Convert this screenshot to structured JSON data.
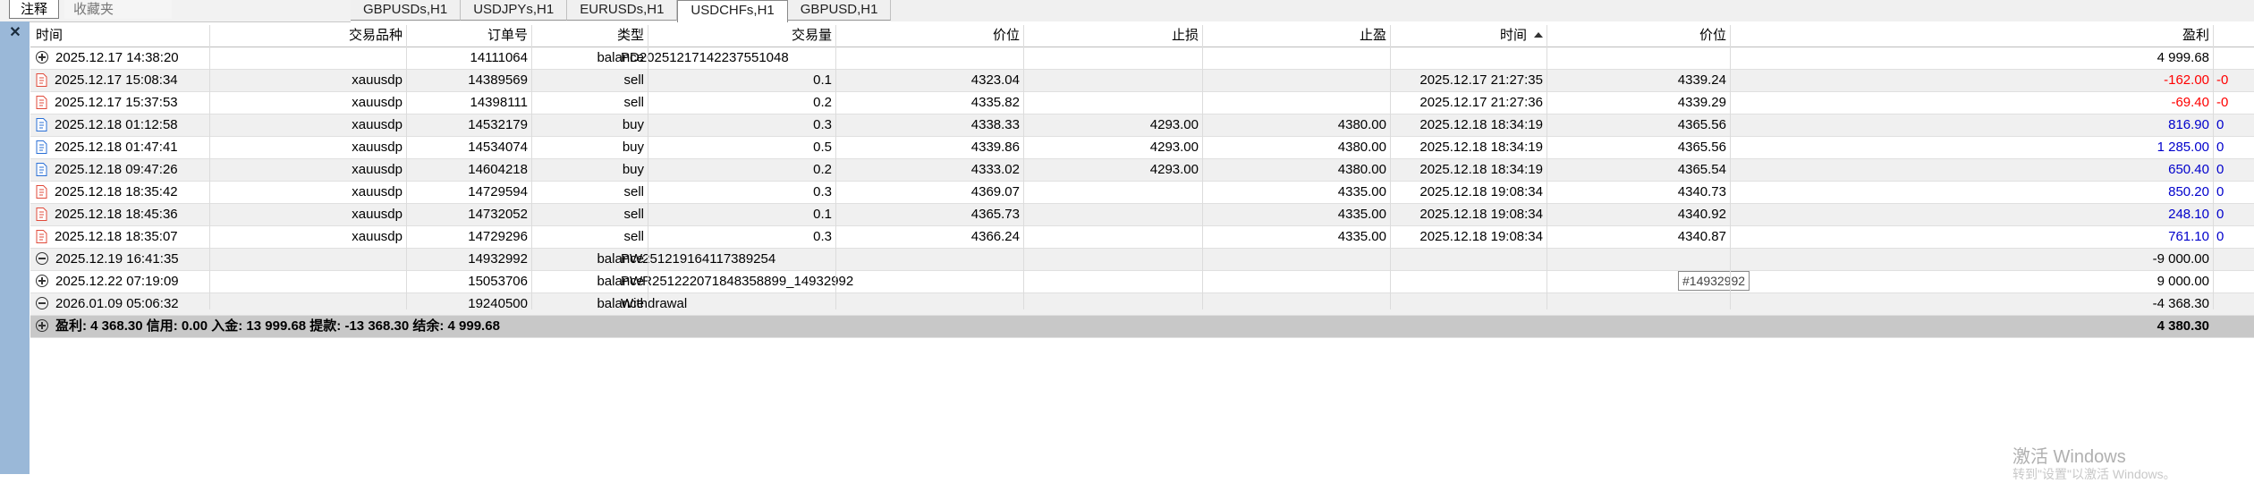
{
  "panel_tabs": {
    "active": "注释",
    "inactive": "收藏夹"
  },
  "chart_tabs": [
    {
      "label": "GBPUSDs,H1",
      "active": false
    },
    {
      "label": "USDJPYs,H1",
      "active": false
    },
    {
      "label": "EURUSDs,H1",
      "active": false
    },
    {
      "label": "USDCHFs,H1",
      "active": true
    },
    {
      "label": "GBPUSD,H1",
      "active": false
    }
  ],
  "close_label": "✕",
  "headers": {
    "time": "时间",
    "symbol": "交易品种",
    "order": "订单号",
    "type": "类型",
    "volume": "交易量",
    "price": "价位",
    "sl": "止损",
    "tp": "止盈",
    "time2": "时间",
    "price2": "价位",
    "profit": "盈利"
  },
  "rows": [
    {
      "kind": "balance",
      "icon": "plus",
      "time": "2025.12.17 14:38:20",
      "order": "14111064",
      "type": "balance",
      "comment": "PD20251217142237551048",
      "profit": "4 999.68",
      "profit_color": "normal",
      "tail": ""
    },
    {
      "kind": "trade",
      "icon": "sell",
      "time": "2025.12.17 15:08:34",
      "symbol": "xauusdp",
      "order": "14389569",
      "type": "sell",
      "volume": "0.1",
      "price": "4323.04",
      "sl": "",
      "tp": "",
      "time2": "2025.12.17 21:27:35",
      "price2": "4339.24",
      "profit": "-162.00",
      "profit_color": "neg",
      "tail": "-0"
    },
    {
      "kind": "trade",
      "icon": "sell",
      "time": "2025.12.17 15:37:53",
      "symbol": "xauusdp",
      "order": "14398111",
      "type": "sell",
      "volume": "0.2",
      "price": "4335.82",
      "sl": "",
      "tp": "",
      "time2": "2025.12.17 21:27:36",
      "price2": "4339.29",
      "profit": "-69.40",
      "profit_color": "neg",
      "tail": "-0"
    },
    {
      "kind": "trade",
      "icon": "buy",
      "time": "2025.12.18 01:12:58",
      "symbol": "xauusdp",
      "order": "14532179",
      "type": "buy",
      "volume": "0.3",
      "price": "4338.33",
      "sl": "4293.00",
      "tp": "4380.00",
      "time2": "2025.12.18 18:34:19",
      "price2": "4365.56",
      "profit": "816.90",
      "profit_color": "pos",
      "tail": "0"
    },
    {
      "kind": "trade",
      "icon": "buy",
      "time": "2025.12.18 01:47:41",
      "symbol": "xauusdp",
      "order": "14534074",
      "type": "buy",
      "volume": "0.5",
      "price": "4339.86",
      "sl": "4293.00",
      "tp": "4380.00",
      "time2": "2025.12.18 18:34:19",
      "price2": "4365.56",
      "profit": "1 285.00",
      "profit_color": "pos",
      "tail": "0"
    },
    {
      "kind": "trade",
      "icon": "buy",
      "time": "2025.12.18 09:47:26",
      "symbol": "xauusdp",
      "order": "14604218",
      "type": "buy",
      "volume": "0.2",
      "price": "4333.02",
      "sl": "4293.00",
      "tp": "4380.00",
      "time2": "2025.12.18 18:34:19",
      "price2": "4365.54",
      "profit": "650.40",
      "profit_color": "pos",
      "tail": "0"
    },
    {
      "kind": "trade",
      "icon": "sell",
      "time": "2025.12.18 18:35:42",
      "symbol": "xauusdp",
      "order": "14729594",
      "type": "sell",
      "volume": "0.3",
      "price": "4369.07",
      "sl": "",
      "tp": "4335.00",
      "time2": "2025.12.18 19:08:34",
      "price2": "4340.73",
      "profit": "850.20",
      "profit_color": "pos",
      "tail": "0"
    },
    {
      "kind": "trade",
      "icon": "sell",
      "time": "2025.12.18 18:45:36",
      "symbol": "xauusdp",
      "order": "14732052",
      "type": "sell",
      "volume": "0.1",
      "price": "4365.73",
      "sl": "",
      "tp": "4335.00",
      "time2": "2025.12.18 19:08:34",
      "price2": "4340.92",
      "profit": "248.10",
      "profit_color": "pos",
      "tail": "0"
    },
    {
      "kind": "trade",
      "icon": "sell",
      "time": "2025.12.18 18:35:07",
      "symbol": "xauusdp",
      "order": "14729296",
      "type": "sell",
      "volume": "0.3",
      "price": "4366.24",
      "sl": "",
      "tp": "4335.00",
      "time2": "2025.12.18 19:08:34",
      "price2": "4340.87",
      "profit": "761.10",
      "profit_color": "pos",
      "tail": "0"
    },
    {
      "kind": "balance",
      "icon": "minus",
      "time": "2025.12.19 16:41:35",
      "order": "14932992",
      "type": "balance",
      "comment": "PW251219164117389254",
      "profit": "-9 000.00",
      "profit_color": "normal",
      "tail": ""
    },
    {
      "kind": "balance",
      "icon": "plus",
      "time": "2025.12.22 07:19:09",
      "order": "15053706",
      "type": "balance",
      "comment": "PWR251222071848358899_14932992",
      "profit": "9 000.00",
      "profit_color": "normal",
      "tail": ""
    },
    {
      "kind": "balance",
      "icon": "minus",
      "time": "2026.01.09 05:06:32",
      "order": "19240500",
      "type": "balance",
      "comment": "Withdrawal",
      "profit": "-4 368.30",
      "profit_color": "normal",
      "tail": ""
    }
  ],
  "summary": {
    "text": "盈利: 4 368.30  信用: 0.00  入金: 13 999.68  提款: -13 368.30  结余: 4 999.68",
    "profit": "4 380.30"
  },
  "tooltip": "#14932992",
  "watermark": {
    "line1": "激活 Windows",
    "line2": "转到\"设置\"以激活 Windows。"
  },
  "colors": {
    "negative": "#ff0000",
    "positive": "#0000cc",
    "sidebar": "#9ab8d8"
  }
}
